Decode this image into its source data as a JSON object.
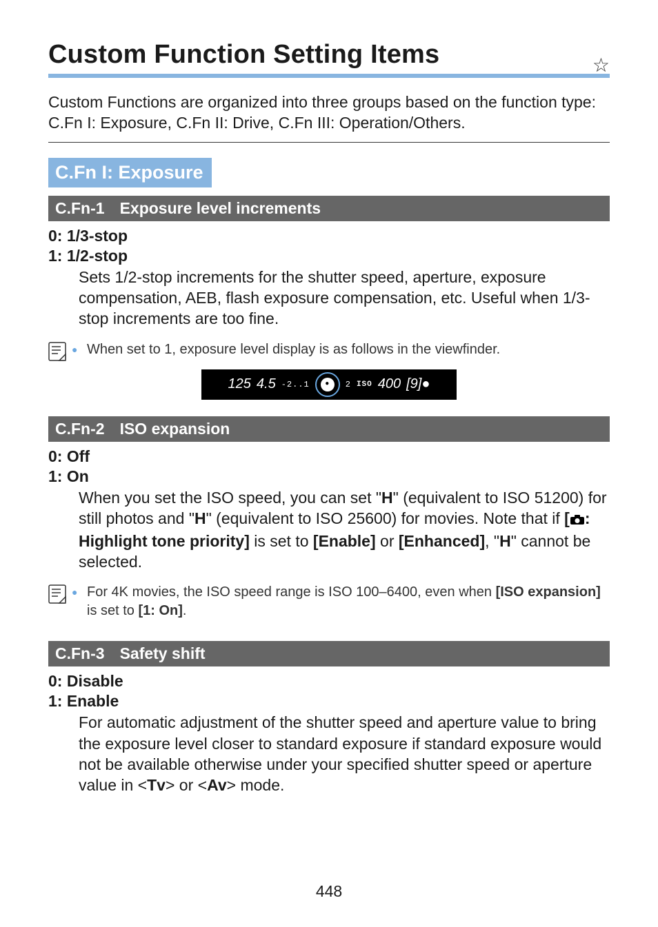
{
  "page": {
    "title": "Custom Function Setting Items",
    "star": "☆",
    "intro": "Custom Functions are organized into three groups based on the function type: C.Fn I: Exposure, C.Fn II: Drive, C.Fn III: Operation/Others.",
    "pageNumber": "448"
  },
  "group1": {
    "heading": "C.Fn I: Exposure"
  },
  "cfn1": {
    "num": "C.Fn-1",
    "title": "Exposure level increments",
    "opt0": "0: 1/3-stop",
    "opt1": "1: 1/2-stop",
    "body": "Sets 1/2-stop increments for the shutter speed, aperture, exposure compensation, AEB, flash exposure compensation, etc. Useful when 1/3-stop increments are too fine.",
    "note": "When set to 1, exposure level display is as follows in the viewfinder."
  },
  "viewfinder": {
    "shutter": "125",
    "aperture": "4.5",
    "scaleLeft": "-2..1",
    "center": "●",
    "scaleRight": "2",
    "isoLabel": "ISO",
    "iso": "400",
    "shots": "[9]●"
  },
  "cfn2": {
    "num": "C.Fn-2",
    "title": "ISO expansion",
    "opt0": "0: Off",
    "opt1": "1: On",
    "body_p1": "When you set the ISO speed, you can set \"",
    "body_h1": "H",
    "body_p2": "\" (equivalent to ISO 51200) for still photos and \"",
    "body_h2": "H",
    "body_p3": "\" (equivalent to ISO 25600) for movies. Note that if ",
    "body_bracket_open": "[",
    "body_highlight": ": Highlight tone priority]",
    "body_p4": " is set to ",
    "body_enable": "[Enable]",
    "body_p5": " or ",
    "body_enhanced": "[Enhanced]",
    "body_p6": ", \"",
    "body_h3": "H",
    "body_p7": "\" cannot be selected.",
    "note_p1": "For 4K movies, the ISO speed range is ISO 100–6400, even when ",
    "note_iso": "[ISO expansion]",
    "note_p2": " is set to ",
    "note_on": "[1: On]",
    "note_p3": "."
  },
  "cfn3": {
    "num": "C.Fn-3",
    "title": "Safety shift",
    "opt0": "0: Disable",
    "opt1": "1: Enable",
    "body_p1": "For automatic adjustment of the shutter speed and aperture value to bring the exposure level closer to standard exposure if standard exposure would not be available otherwise under your specified shutter speed or aperture value in <",
    "body_tv": "Tv",
    "body_p2": "> or <",
    "body_av": "Av",
    "body_p3": "> mode."
  }
}
